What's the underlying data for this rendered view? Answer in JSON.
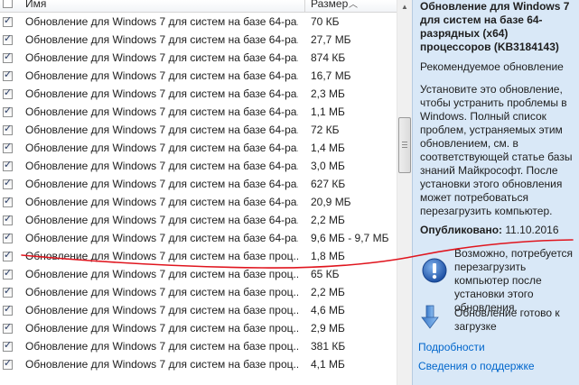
{
  "columns": {
    "name": "Имя",
    "size": "Размер"
  },
  "updates": [
    {
      "checked": true,
      "name": "Обновление для Windows 7 для систем на базе 64-ра...",
      "size": "70 КБ"
    },
    {
      "checked": true,
      "name": "Обновление для Windows 7 для систем на базе 64-ра...",
      "size": "27,7 МБ"
    },
    {
      "checked": true,
      "name": "Обновление для Windows 7 для систем на базе 64-ра...",
      "size": "874 КБ"
    },
    {
      "checked": true,
      "name": "Обновление для Windows 7 для систем на базе 64-ра...",
      "size": "16,7 МБ"
    },
    {
      "checked": true,
      "name": "Обновление для Windows 7 для систем на базе 64-ра...",
      "size": "2,3 МБ"
    },
    {
      "checked": true,
      "name": "Обновление для Windows 7 для систем на базе 64-ра...",
      "size": "1,1 МБ"
    },
    {
      "checked": true,
      "name": "Обновление для Windows 7 для систем на базе 64-ра...",
      "size": "72 КБ"
    },
    {
      "checked": true,
      "name": "Обновление для Windows 7 для систем на базе 64-ра...",
      "size": "1,4 МБ"
    },
    {
      "checked": true,
      "name": "Обновление для Windows 7 для систем на базе 64-ра...",
      "size": "3,0 МБ"
    },
    {
      "checked": true,
      "name": "Обновление для Windows 7 для систем на базе 64-ра...",
      "size": "627 КБ"
    },
    {
      "checked": true,
      "name": "Обновление для Windows 7 для систем на базе 64-ра...",
      "size": "20,9 МБ"
    },
    {
      "checked": true,
      "name": "Обновление для Windows 7 для систем на базе 64-ра...",
      "size": "2,2 МБ"
    },
    {
      "checked": true,
      "name": "Обновление для Windows 7 для систем на базе 64-ра...",
      "size": "9,6 МБ - 9,7 МБ"
    },
    {
      "checked": true,
      "name": "Обновление для Windows 7 для систем на базе проц...",
      "size": "1,8 МБ"
    },
    {
      "checked": true,
      "name": "Обновление для Windows 7 для систем на базе проц...",
      "size": "65 КБ"
    },
    {
      "checked": true,
      "name": "Обновление для Windows 7 для систем на базе проц...",
      "size": "2,2 МБ"
    },
    {
      "checked": true,
      "name": "Обновление для Windows 7 для систем на базе проц...",
      "size": "4,6 МБ"
    },
    {
      "checked": true,
      "name": "Обновление для Windows 7 для систем на базе проц...",
      "size": "2,9 МБ"
    },
    {
      "checked": true,
      "name": "Обновление для Windows 7 для систем на базе проц...",
      "size": "381 КБ"
    },
    {
      "checked": true,
      "name": "Обновление для Windows 7 для систем на базе проц...",
      "size": "4,1 МБ"
    }
  ],
  "details": {
    "title": "Обновление для Windows 7 для систем на базе 64-разрядных (x64) процессоров (KB3184143)",
    "category": "Рекомендуемое обновление",
    "description": "Установите это обновление, чтобы устранить проблемы в Windows. Полный список проблем, устраняемых этим обновлением, см. в соответствующей статье базы знаний Майкрософт. После установки этого обновления может потребоваться перезагрузить компьютер.",
    "published_label": "Опубликовано:",
    "published_date": "11.10.2016",
    "restart_note": "Возможно, потребуется перезагрузить компьютер после установки этого обновления.",
    "download_note": "Обновление готово к загрузке",
    "links": {
      "more_info": "Подробности",
      "support_info": "Сведения о поддержке"
    }
  },
  "colors": {
    "details_bg": "#d9e8f7",
    "link": "#0066cc",
    "annotation": "#e0151e",
    "checkmark": "#2a3e67"
  },
  "annotation": {
    "type": "hand-drawn red line under highlighted update row"
  }
}
